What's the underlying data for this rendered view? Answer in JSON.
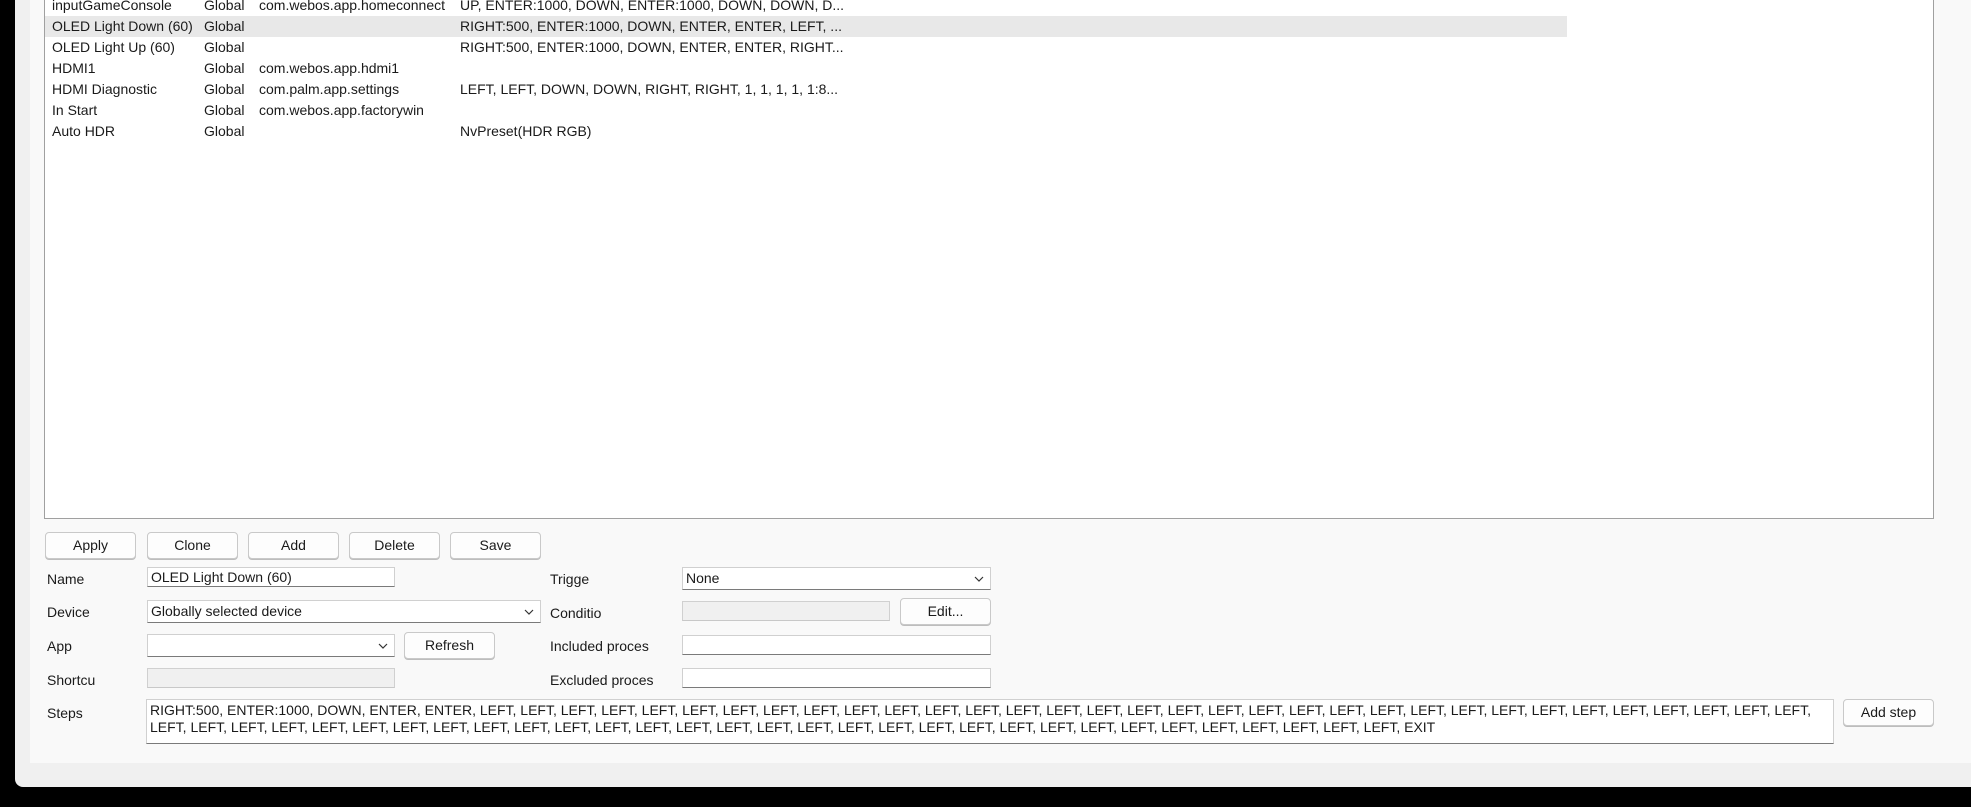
{
  "list": {
    "rows": [
      {
        "name": "inputGameConsole",
        "scope": "Global",
        "app": "com.webos.app.homeconnect",
        "steps": "UP, ENTER:1000, DOWN, ENTER:1000, DOWN, DOWN, D..."
      },
      {
        "name": "OLED Light Down (60)",
        "scope": "Global",
        "app": "",
        "steps": "RIGHT:500, ENTER:1000, DOWN, ENTER, ENTER, LEFT, ..."
      },
      {
        "name": "OLED Light Up (60)",
        "scope": "Global",
        "app": "",
        "steps": "RIGHT:500, ENTER:1000, DOWN, ENTER, ENTER, RIGHT..."
      },
      {
        "name": "HDMI1",
        "scope": "Global",
        "app": "com.webos.app.hdmi1",
        "steps": ""
      },
      {
        "name": "HDMI Diagnostic",
        "scope": "Global",
        "app": "com.palm.app.settings",
        "steps": "LEFT, LEFT, DOWN, DOWN, RIGHT, RIGHT, 1, 1, 1, 1, 1:8..."
      },
      {
        "name": "In Start",
        "scope": "Global",
        "app": "com.webos.app.factorywin",
        "steps": ""
      },
      {
        "name": "Auto HDR",
        "scope": "Global",
        "app": "",
        "steps": "NvPreset(HDR RGB)"
      }
    ],
    "selected_index": 1
  },
  "buttons": {
    "apply": "Apply",
    "clone": "Clone",
    "add": "Add",
    "delete": "Delete",
    "save": "Save",
    "refresh": "Refresh",
    "edit": "Edit...",
    "add_step": "Add step"
  },
  "form": {
    "name_label": "Name",
    "name_value": "OLED Light Down (60)",
    "device_label": "Device",
    "device_value": "Globally selected device",
    "app_label": "App",
    "app_value": "",
    "shortcut_label": "Shortcu",
    "shortcut_value": "",
    "steps_label": "Steps",
    "steps_value": "RIGHT:500, ENTER:1000, DOWN, ENTER, ENTER, LEFT, LEFT, LEFT, LEFT, LEFT, LEFT, LEFT, LEFT, LEFT, LEFT, LEFT, LEFT, LEFT, LEFT, LEFT, LEFT, LEFT, LEFT, LEFT, LEFT, LEFT, LEFT, LEFT, LEFT, LEFT, LEFT, LEFT, LEFT, LEFT, LEFT, LEFT, LEFT, LEFT, LEFT, LEFT, LEFT, LEFT, LEFT, LEFT, LEFT, LEFT, LEFT, LEFT, LEFT, LEFT, LEFT, LEFT, LEFT, LEFT, LEFT, LEFT, LEFT, LEFT, LEFT, LEFT, LEFT, LEFT, LEFT, LEFT, LEFT, LEFT, LEFT, LEFT, LEFT, EXIT",
    "trigger_label": "Trigge",
    "trigger_value": "None",
    "condition_label": "Conditio",
    "condition_value": "",
    "included_label": "Included proces",
    "included_value": "",
    "excluded_label": "Excluded proces",
    "excluded_value": ""
  },
  "icons": {
    "dropdown": "chevron-down-icon"
  },
  "colors": {
    "window_bg": "#f0f0f0",
    "panel_bg": "#f9f9f9",
    "selected_row": "#e8e8e8",
    "outer_bg": "#000000"
  }
}
